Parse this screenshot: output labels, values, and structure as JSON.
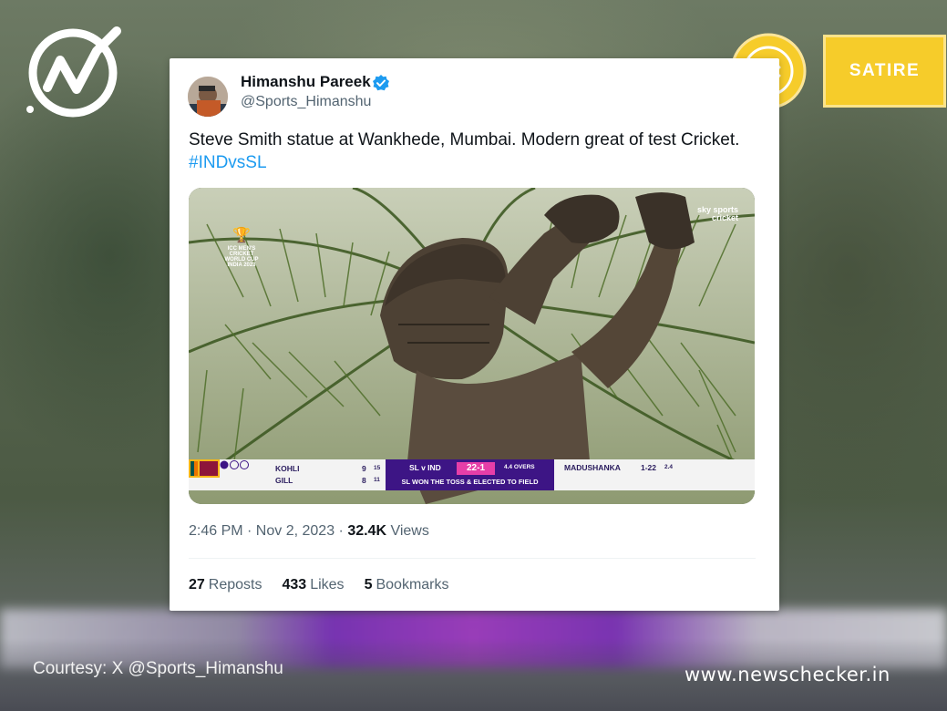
{
  "tweet": {
    "author_name": "Himanshu Pareek",
    "author_handle": "@Sports_Himanshu",
    "text": "Steve Smith statue at Wankhede, Mumbai. Modern great of test Cricket.",
    "hashtag": "#INDvsSL",
    "time": "2:46 PM · Nov 2, 2023 ·",
    "views_count": "32.4K",
    "views_label": "Views",
    "reposts_count": "27",
    "reposts_label": "Reposts",
    "likes_count": "433",
    "likes_label": "Likes",
    "bookmarks_count": "5",
    "bookmarks_label": "Bookmarks"
  },
  "media": {
    "wc_logo_line1": "ICC MEN'S",
    "wc_logo_line2": "CRICKET",
    "wc_logo_line3": "WORLD CUP",
    "wc_logo_line4": "INDIA 2023",
    "broadcaster_line1": "sky sports",
    "broadcaster_line2": "cricket",
    "scoreboard": {
      "batter1_name": "KOHLI",
      "batter1_runs": "9",
      "batter1_balls": "15",
      "batter2_name": "GILL",
      "batter2_runs": "8",
      "batter2_balls": "11",
      "match": "SL v IND",
      "score": "22-1",
      "overs": "4.4 OVERS",
      "status": "SL WON THE TOSS & ELECTED TO FIELD",
      "bowler_name": "MADUSHANKA",
      "bowler_figures": "1-22",
      "bowler_overs": "2.4"
    }
  },
  "badge": {
    "label": "SATIRE"
  },
  "footer": {
    "courtesy": "Courtesy: X @Sports_Himanshu",
    "site": "www.newschecker.in"
  },
  "colors": {
    "badge_yellow": "#f6cc2a",
    "link_blue": "#1d9bf0",
    "score_purple": "#3d1585",
    "score_pink": "#e63ea8"
  },
  "icons": [
    "newschecker-logo-icon",
    "smiley-icon",
    "verified-icon",
    "avatar",
    "india-flag-icon",
    "sri-lanka-flag-icon"
  ]
}
